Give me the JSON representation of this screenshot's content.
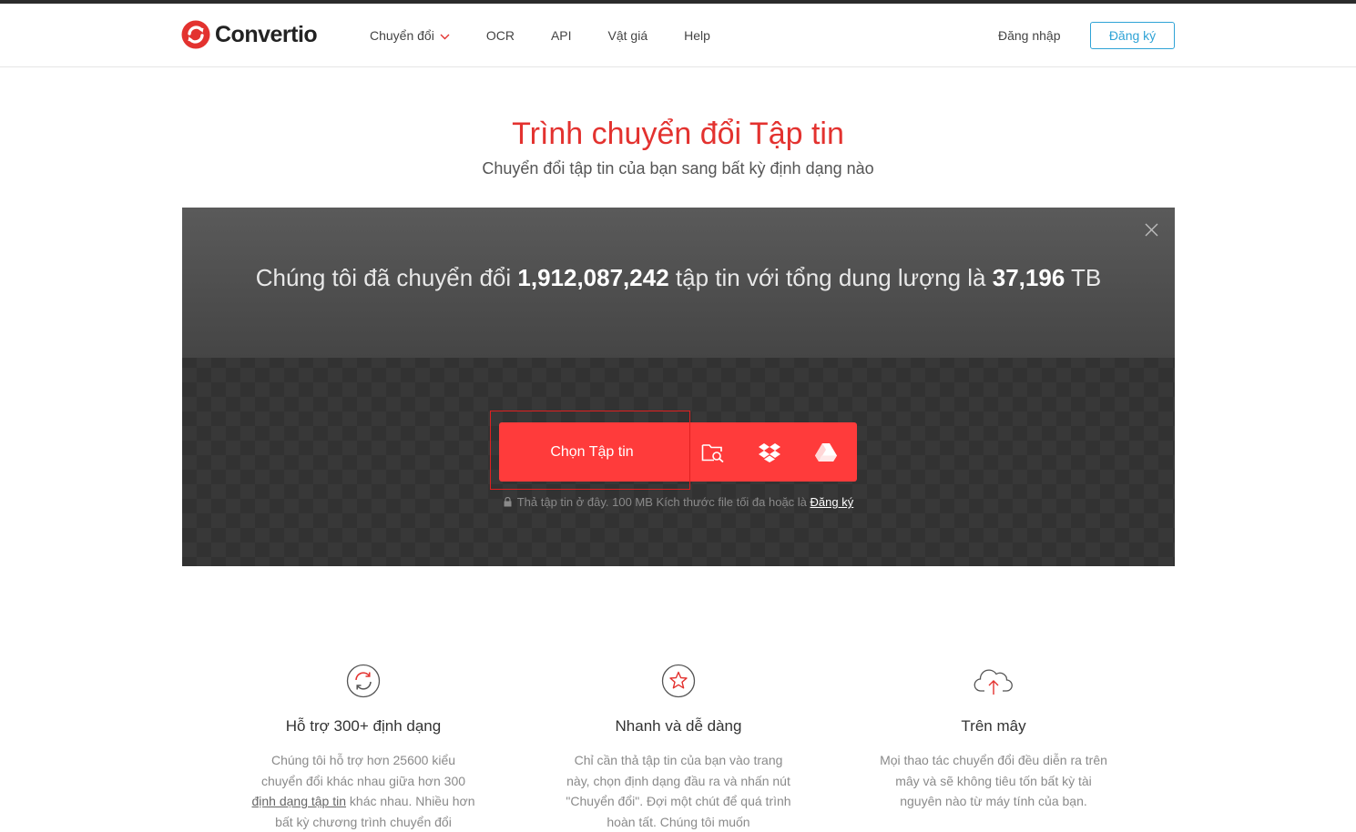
{
  "brand": {
    "name": "Convertio",
    "accent": "#e3322f",
    "link_color": "#2fa3d6"
  },
  "nav": {
    "items": [
      {
        "label": "Chuyển đổi",
        "has_dropdown": true
      },
      {
        "label": "OCR"
      },
      {
        "label": "API"
      },
      {
        "label": "Vật giá"
      },
      {
        "label": "Help"
      }
    ],
    "login": "Đăng nhập",
    "signup": "Đăng ký"
  },
  "hero": {
    "title": "Trình chuyển đổi Tập tin",
    "subtitle": "Chuyển đổi tập tin của bạn sang bất kỳ định dạng nào"
  },
  "stats": {
    "prefix": "Chúng tôi đã chuyển đổi",
    "files_count": "1,912,087,242",
    "middle": "tập tin với tổng dung lượng là",
    "total_size": "37,196",
    "unit": "TB"
  },
  "upload": {
    "choose_label": "Chọn Tập tin",
    "sources": [
      "folder-search-icon",
      "dropbox-icon",
      "google-drive-icon"
    ],
    "hint_text": "Thả tập tin ở đây. 100 MB Kích thước file tối đa hoặc là",
    "hint_link": "Đăng ký"
  },
  "features": [
    {
      "icon": "refresh-icon",
      "title": "Hỗ trợ 300+ định dạng",
      "text_before": "Chúng tôi hỗ trợ hơn 25600 kiểu chuyển đổi khác nhau giữa hơn 300",
      "text_link": "định dạng tập tin",
      "text_after": "khác nhau. Nhiều hơn bất kỳ chương trình chuyển đổi"
    },
    {
      "icon": "star-icon",
      "title": "Nhanh và dễ dàng",
      "text": "Chỉ cần thả tập tin của bạn vào trang này, chọn định dạng đầu ra và nhấn nút \"Chuyển đổi\". Đợi một chút để quá trình hoàn tất. Chúng tôi muốn"
    },
    {
      "icon": "cloud-upload-icon",
      "title": "Trên mây",
      "text": "Mọi thao tác chuyển đổi đều diễn ra trên mây và sẽ không tiêu tốn bất kỳ tài nguyên nào từ máy tính của bạn."
    }
  ]
}
